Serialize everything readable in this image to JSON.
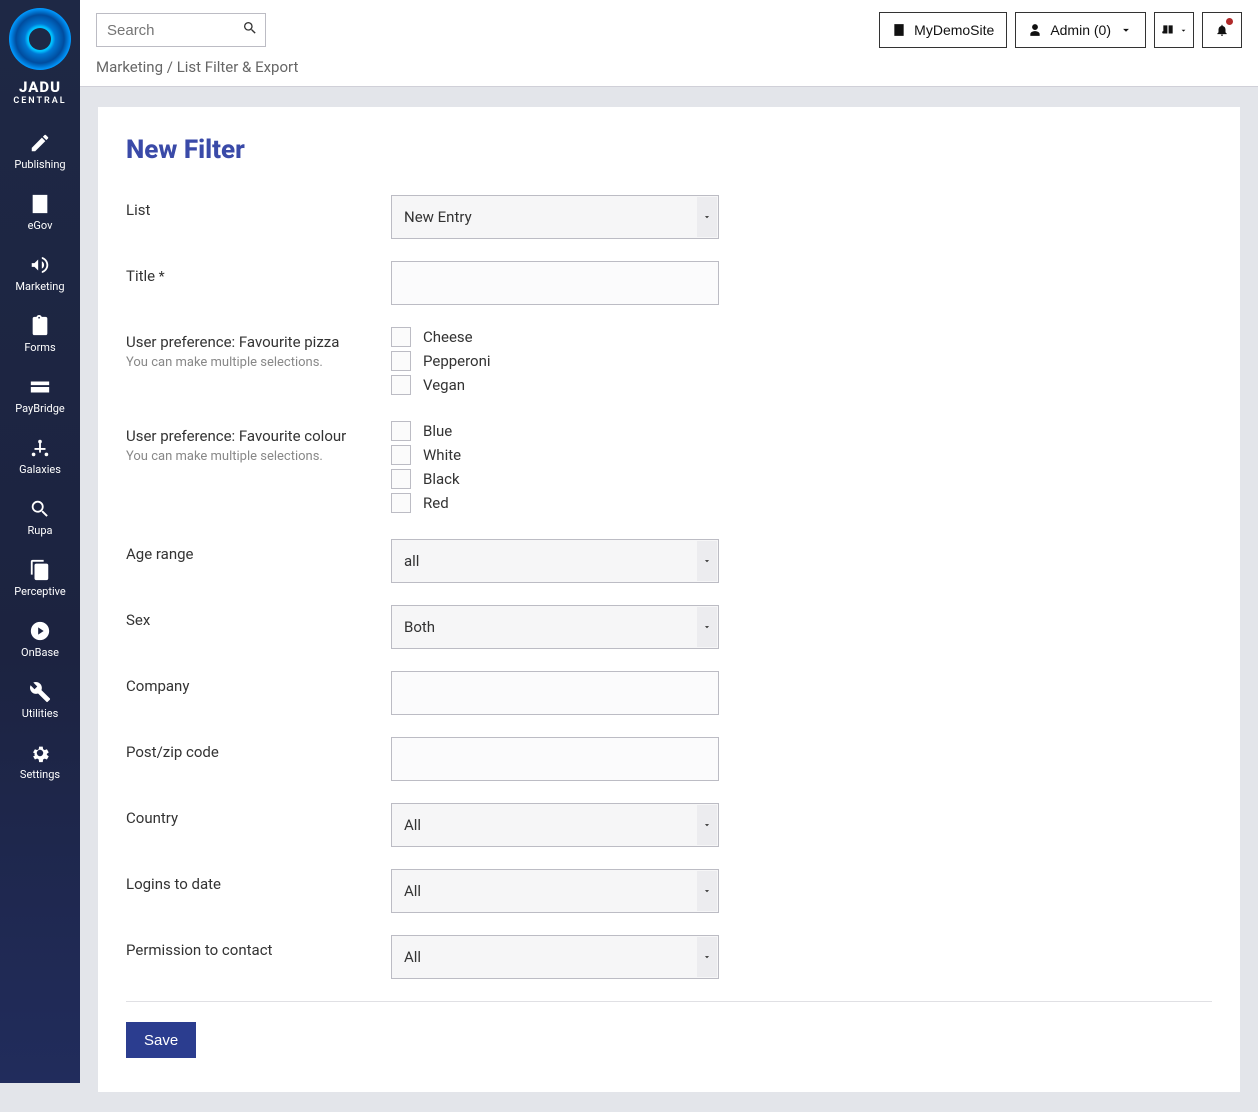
{
  "brand": {
    "main": "JADU",
    "sub": "CENTRAL"
  },
  "nav": [
    {
      "icon": "pencil",
      "label": "Publishing"
    },
    {
      "icon": "building",
      "label": "eGov"
    },
    {
      "icon": "bullhorn",
      "label": "Marketing"
    },
    {
      "icon": "clipboard",
      "label": "Forms"
    },
    {
      "icon": "card",
      "label": "PayBridge"
    },
    {
      "icon": "nodes",
      "label": "Galaxies"
    },
    {
      "icon": "search",
      "label": "Rupa"
    },
    {
      "icon": "copy",
      "label": "Perceptive"
    },
    {
      "icon": "play-circle",
      "label": "OnBase"
    },
    {
      "icon": "wrench",
      "label": "Utilities"
    },
    {
      "icon": "gear",
      "label": "Settings"
    }
  ],
  "search_placeholder": "Search",
  "top": {
    "site": "MyDemoSite",
    "admin": "Admin (0)"
  },
  "breadcrumb": {
    "parent": "Marketing",
    "sep": "/",
    "current": "List Filter & Export"
  },
  "page_title": "New Filter",
  "form": {
    "list": {
      "label": "List",
      "value": "New Entry"
    },
    "title": {
      "label": "Title",
      "required": "*"
    },
    "pizza": {
      "label": "User preference: Favourite pizza",
      "hint": "You can make multiple selections.",
      "options": [
        "Cheese",
        "Pepperoni",
        "Vegan"
      ]
    },
    "colour": {
      "label": "User preference: Favourite colour",
      "hint": "You can make multiple selections.",
      "options": [
        "Blue",
        "White",
        "Black",
        "Red"
      ]
    },
    "age": {
      "label": "Age range",
      "value": "all"
    },
    "sex": {
      "label": "Sex",
      "value": "Both"
    },
    "company": {
      "label": "Company"
    },
    "postcode": {
      "label": "Post/zip code"
    },
    "country": {
      "label": "Country",
      "value": "All"
    },
    "logins": {
      "label": "Logins to date",
      "value": "All"
    },
    "permission": {
      "label": "Permission to contact",
      "value": "All"
    }
  },
  "save_label": "Save"
}
